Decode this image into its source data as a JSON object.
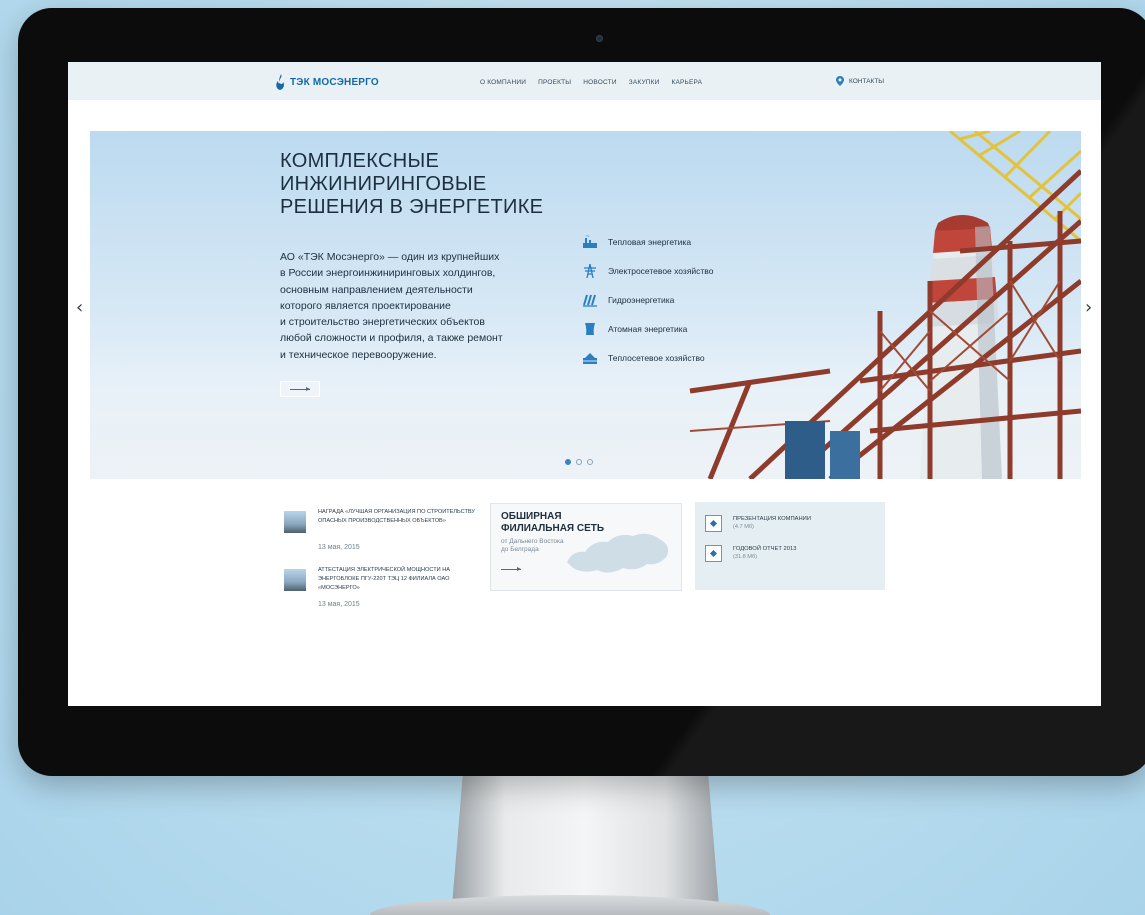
{
  "header": {
    "logo_text": "ТЭК МОСЭНЕРГО",
    "nav": [
      "О КОМПАНИИ",
      "ПРОЕКТЫ",
      "НОВОСТИ",
      "ЗАКУПКИ",
      "КАРЬЕРА"
    ],
    "contacts_label": "КОНТАКТЫ"
  },
  "hero": {
    "title_lines": [
      "КОМПЛЕКСНЫЕ",
      "ИНЖИНИРИНГОВЫЕ",
      "РЕШЕНИЯ В ЭНЕРГЕТИКЕ"
    ],
    "description_lines": [
      "АО «ТЭК Мосэнерго» — один из крупнейших",
      "в России энергоинжиниринговых холдингов,",
      "основным направлением деятельности",
      "которого является проектирование",
      "и строительство энергетических объектов",
      "любой сложности и профиля, а также ремонт",
      "и техническое перевооружение."
    ],
    "sectors": [
      {
        "label": "Тепловая энергетика",
        "icon": "thermal-plant-icon"
      },
      {
        "label": "Электросетевое хозяйство",
        "icon": "power-tower-icon"
      },
      {
        "label": "Гидроэнергетика",
        "icon": "hydro-dam-icon"
      },
      {
        "label": "Атомная энергетика",
        "icon": "nuclear-plant-icon"
      },
      {
        "label": "Теплосетевое хозяйство",
        "icon": "heating-network-icon"
      }
    ],
    "slide_count": 3,
    "active_slide": 1
  },
  "news": [
    {
      "title": "НАГРАДА «ЛУЧШАЯ ОРГАНИЗАЦИЯ ПО СТРОИТЕЛЬСТВУ ОПАСНЫХ ПРОИЗВОДСТВЕННЫХ ОБЪЕКТОВ»",
      "date": "13 мая, 2015"
    },
    {
      "title": "АТТЕСТАЦИЯ ЭЛЕКТРИЧЕСКОЙ МОЩНОСТИ НА ЭНЕРГОБЛОКЕ ПГУ-220Т ТЭЦ 12 ФИЛИАЛА ОАО «МОСЭНЕРГО»",
      "date": "13 мая, 2015"
    }
  ],
  "branch": {
    "title_lines": [
      "ОБШИРНАЯ",
      "ФИЛИАЛЬНАЯ СЕТЬ"
    ],
    "subtitle_lines": [
      "от Дальнего Востока",
      "до Белграда"
    ]
  },
  "documents": [
    {
      "title": "ПРЕЗЕНТАЦИЯ КОМПАНИИ",
      "size": "(4.7 Мб)"
    },
    {
      "title": "ГОДОВОЙ ОТЧЕТ 2013",
      "size": "(31.8 Мб)"
    }
  ],
  "colors": {
    "brand_blue": "#1469a9",
    "accent_blue": "#3b82c4",
    "header_bg": "#e9f1f4"
  }
}
